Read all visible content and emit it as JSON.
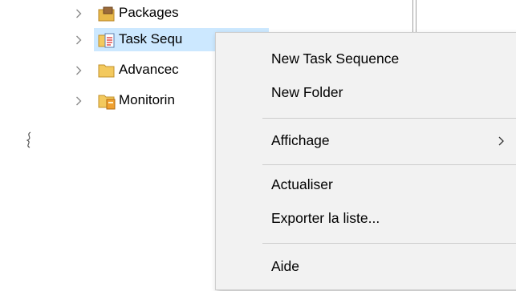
{
  "tree": {
    "items": [
      {
        "label": "Packages",
        "icon": "package-folder-icon"
      },
      {
        "label": "Task Sequ",
        "icon": "task-sequence-folder-icon",
        "selected": true
      },
      {
        "label": "Advancec",
        "icon": "folder-icon"
      },
      {
        "label": "Monitorin",
        "icon": "monitoring-folder-icon"
      }
    ]
  },
  "context_menu": {
    "items": [
      {
        "label": "New Task Sequence"
      },
      {
        "label": "New Folder"
      },
      {
        "label": "Affichage",
        "has_submenu": true
      },
      {
        "label": "Actualiser"
      },
      {
        "label": "Exporter la liste..."
      },
      {
        "label": "Aide"
      }
    ]
  },
  "colors": {
    "selection": "#cce8ff",
    "menu_background": "#f2f2f2",
    "separator": "#cdcdcd"
  }
}
